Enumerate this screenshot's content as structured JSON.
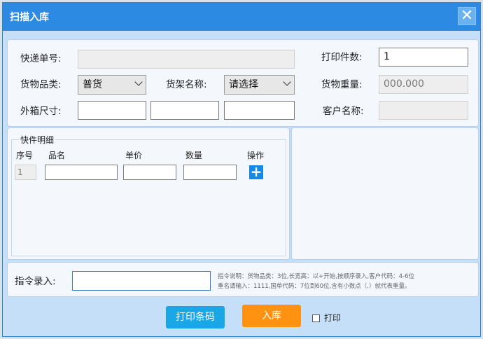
{
  "window": {
    "title": "扫描入库",
    "close_glyph": "✕"
  },
  "form": {
    "tracking_label": "快递单号:",
    "tracking_value": "",
    "print_count_label": "打印件数:",
    "print_count_value": "1",
    "category_label": "货物品类:",
    "category_selected": "普货",
    "shelf_label": "货架名称:",
    "shelf_selected": "请选择",
    "weight_label": "货物重量:",
    "weight_value": "000.000",
    "box_size_label": "外箱尺寸:",
    "customer_label": "客户名称:",
    "customer_value": ""
  },
  "items": {
    "group_title": "快件明细",
    "columns": [
      "序号",
      "品名",
      "单价",
      "数量",
      "操作"
    ],
    "row_index": "1",
    "add_glyph": "+"
  },
  "command": {
    "label": "指令录入:",
    "value": "",
    "hint_line1": "指令说明：货物品类：3位,长宽高：以+开始,按顺序录入,客户代码：4-6位",
    "hint_line2": "重名请输入：1111,国单代码：7位到60位,含有小数点（.）就代表重量。"
  },
  "actions": {
    "print_barcode": "打印条码",
    "stock_in": "入库",
    "print_checkbox_label": "打印"
  },
  "colors": {
    "title_bar": "#2d8ae3",
    "print_button": "#19a7e6",
    "stock_in_button": "#ff9210",
    "add_button": "#1688e6"
  }
}
